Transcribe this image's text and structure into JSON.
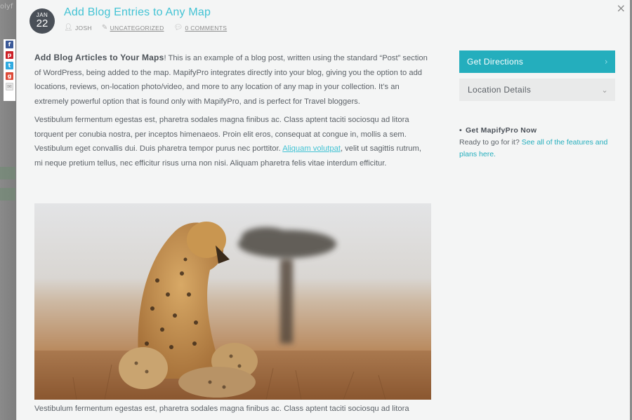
{
  "background": {
    "logo_text": "olyf"
  },
  "share_bar": [
    {
      "name": "facebook-share-icon",
      "glyph": "f",
      "cls": "fb"
    },
    {
      "name": "pinterest-share-icon",
      "glyph": "p",
      "cls": "pin"
    },
    {
      "name": "twitter-share-icon",
      "glyph": "t",
      "cls": "tw"
    },
    {
      "name": "google-plus-share-icon",
      "glyph": "g",
      "cls": "gp"
    },
    {
      "name": "email-share-icon",
      "glyph": "✉",
      "cls": "mail"
    }
  ],
  "modal": {
    "close_glyph": "×"
  },
  "post": {
    "date_month": "JAN",
    "date_day": "22",
    "title": "Add Blog Entries to Any Map",
    "author": "JOSH",
    "category": "UNCATEGORIZED",
    "comments": "0 COMMENTS",
    "intro_bold": "Add Blog Articles to Your Maps",
    "intro_rest": "! This is an example of a blog post, written using the standard “Post” section of WordPress, being added to the map. MapifyPro integrates directly into your blog, giving you the option to add locations, reviews, on-location photo/video, and more to any location of any map in your collection. It’s an extremely powerful option that is found only with MapifyPro, and is perfect for Travel bloggers.",
    "para2_before_link": "Vestibulum fermentum egestas est, pharetra sodales magna finibus ac. Class aptent taciti sociosqu ad litora torquent per conubia nostra, per inceptos himenaeos. Proin elit eros, consequat at congue in, mollis a sem. Vestibulum eget convallis dui. Duis pharetra tempor purus nec porttitor. ",
    "para2_link": "Aliquam volutpat",
    "para2_after_link": ", velit ut sagittis rutrum, mi neque pretium tellus, nec efficitur risus urna non nisi. Aliquam pharetra felis vitae interdum efficitur.",
    "caption": "Vestibulum fermentum egestas est, pharetra sodales magna finibus ac. Class aptent taciti sociosqu ad litora"
  },
  "sidebar": {
    "directions_label": "Get Directions",
    "directions_chevron": "›",
    "location_label": "Location Details",
    "location_chevron": "⌄",
    "promo_heading": "Get MapifyPro Now",
    "promo_text": "Ready to go for it? ",
    "promo_link": "See all of the features and plans here."
  },
  "colors": {
    "accent": "#43c3d4",
    "button": "#24aebd",
    "badge": "#4a5058"
  }
}
